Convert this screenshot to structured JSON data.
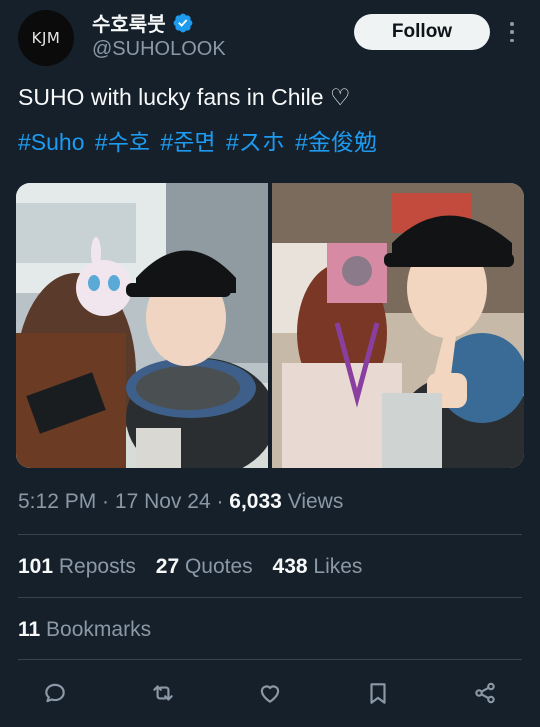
{
  "author": {
    "avatar_text": "KJM",
    "display_name": "수호룩붓",
    "handle": "@SUHOLOOK",
    "verified_icon": "verified-badge-icon"
  },
  "header": {
    "follow_label": "Follow",
    "more_icon": "more-options-icon"
  },
  "tweet": {
    "text": "SUHO with lucky fans in Chile ♡",
    "hashtags": [
      "#Suho",
      "#수호",
      "#준면",
      "#スホ",
      "#金俊勉"
    ]
  },
  "meta": {
    "time": "5:12 PM",
    "sep1": " · ",
    "date": "17 Nov 24",
    "sep2": " · ",
    "views_count": "6,033",
    "views_label": " Views"
  },
  "stats": {
    "reposts_count": "101",
    "reposts_label": " Reposts",
    "quotes_count": "27",
    "quotes_label": " Quotes",
    "likes_count": "438",
    "likes_label": " Likes",
    "bookmarks_count": "11",
    "bookmarks_label": " Bookmarks"
  },
  "actions": [
    "reply-icon",
    "repost-icon",
    "like-icon",
    "bookmark-icon",
    "share-icon"
  ],
  "colors": {
    "background": "#15202b",
    "accent": "#1d9bf0",
    "muted": "#8b98a5",
    "text": "#f7f9f9"
  }
}
